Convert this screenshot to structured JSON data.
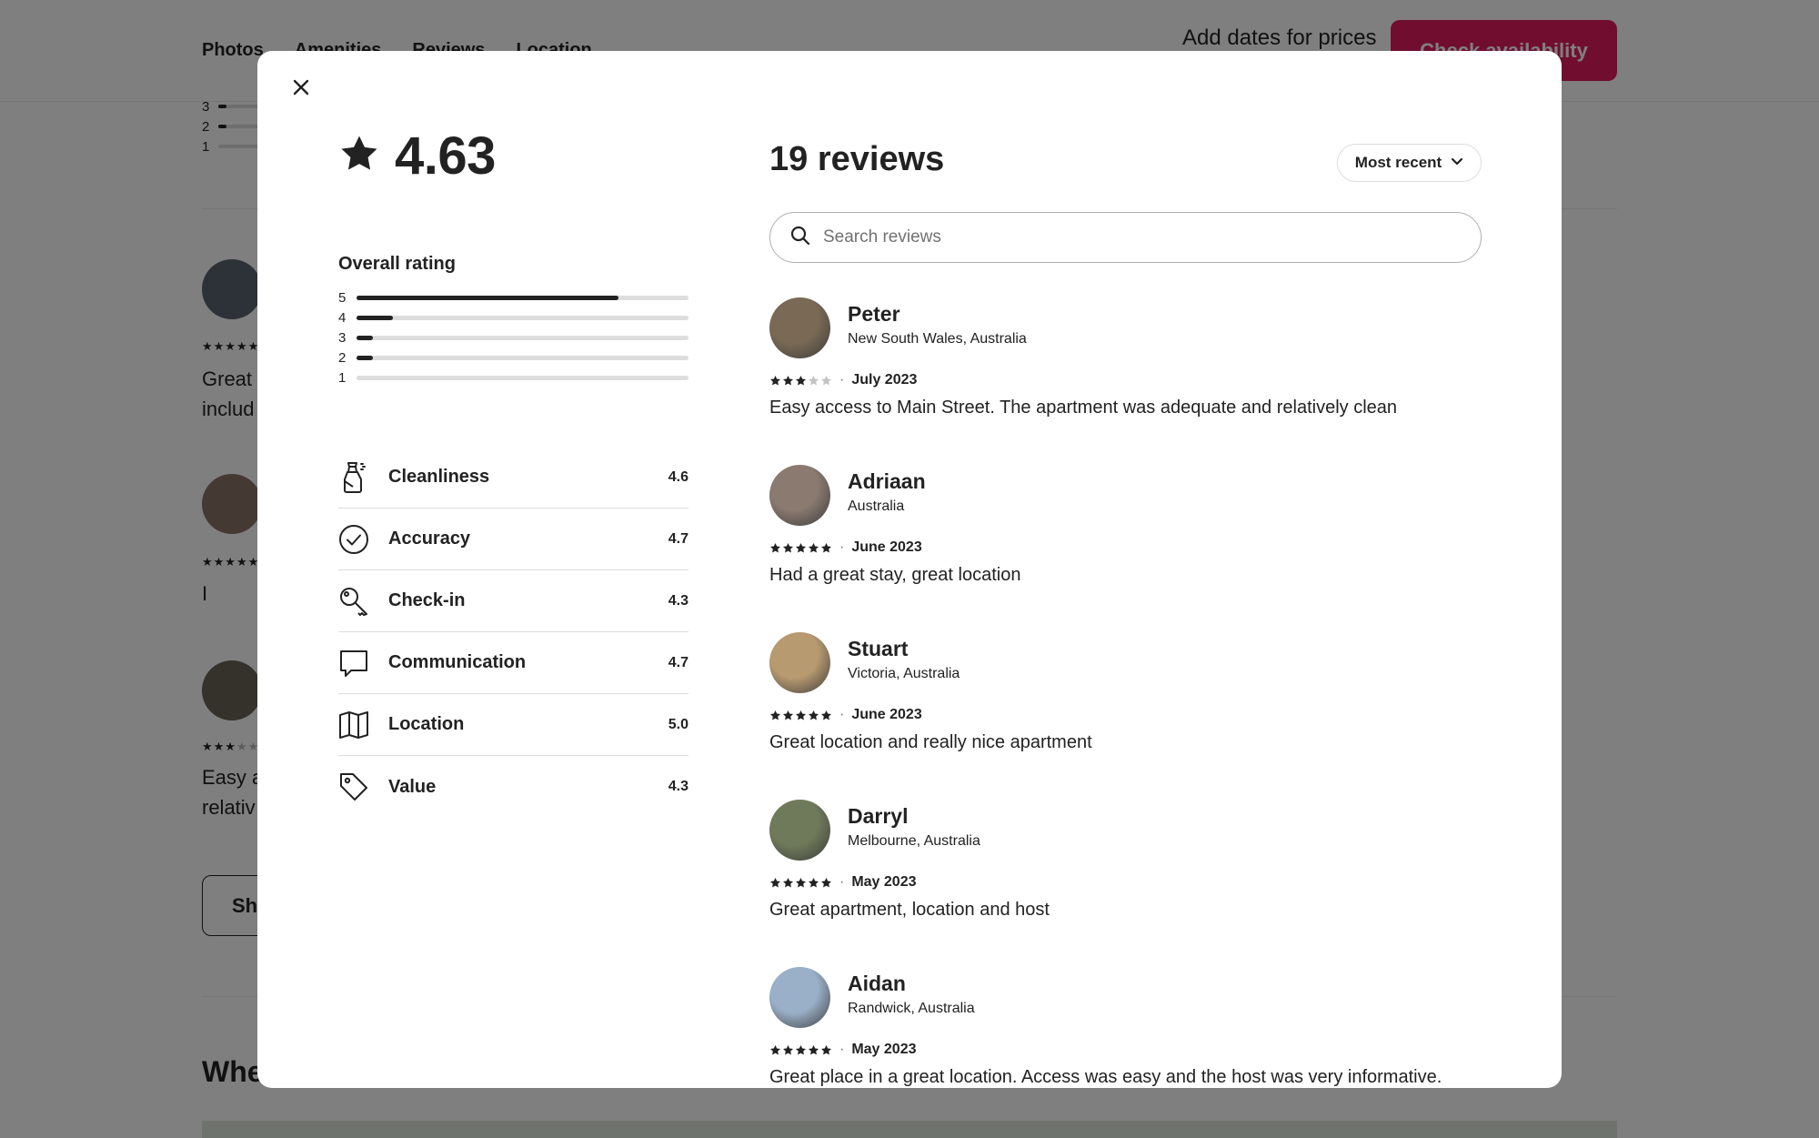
{
  "background": {
    "nav_tabs": [
      "Photos",
      "Amenities",
      "Reviews",
      "Location"
    ],
    "price_prompt": "Add dates for prices",
    "check_button": "Check availability",
    "bar_labels": [
      "3",
      "2",
      "1"
    ],
    "snippet_1": [
      "Great",
      "includ"
    ],
    "snippet_2": [
      "I"
    ],
    "snippet_3": [
      "Easy a",
      "relativ"
    ],
    "show_button": "Sh",
    "section_heading": "Whe"
  },
  "modal": {
    "overall_score": "4.63",
    "overall_label": "Overall rating",
    "distribution": [
      {
        "label": "5",
        "fraction": 0.79
      },
      {
        "label": "4",
        "fraction": 0.11
      },
      {
        "label": "3",
        "fraction": 0.05
      },
      {
        "label": "2",
        "fraction": 0.05
      },
      {
        "label": "1",
        "fraction": 0.0
      }
    ],
    "categories": [
      {
        "name": "Cleanliness",
        "score": "4.6",
        "icon": "spray-bottle-icon"
      },
      {
        "name": "Accuracy",
        "score": "4.7",
        "icon": "check-circle-icon"
      },
      {
        "name": "Check-in",
        "score": "4.3",
        "icon": "key-icon"
      },
      {
        "name": "Communication",
        "score": "4.7",
        "icon": "chat-bubble-icon"
      },
      {
        "name": "Location",
        "score": "5.0",
        "icon": "map-icon"
      },
      {
        "name": "Value",
        "score": "4.3",
        "icon": "tag-icon"
      }
    ],
    "review_count": "19 reviews",
    "sort_label": "Most recent",
    "search_placeholder": "Search reviews",
    "reviews": [
      {
        "name": "Peter",
        "location": "New South Wales, Australia",
        "rating": 3,
        "date": "July 2023",
        "text": "Easy access to Main Street. The apartment was adequate and relatively clean",
        "avatar_color": "#7a6a55"
      },
      {
        "name": "Adriaan",
        "location": "Australia",
        "rating": 5,
        "date": "June 2023",
        "text": "Had a great stay, great location",
        "avatar_color": "#8a7a70"
      },
      {
        "name": "Stuart",
        "location": "Victoria, Australia",
        "rating": 5,
        "date": "June 2023",
        "text": "Great location and really nice apartment",
        "avatar_color": "#b89a70"
      },
      {
        "name": "Darryl",
        "location": "Melbourne, Australia",
        "rating": 5,
        "date": "May 2023",
        "text": "Great apartment, location and host",
        "avatar_color": "#6f7a5a"
      },
      {
        "name": "Aidan",
        "location": "Randwick, Australia",
        "rating": 5,
        "date": "May 2023",
        "text": "Great place in a great location. Access was easy and the host was very informative.",
        "avatar_color": "#9ab0c8"
      }
    ]
  }
}
